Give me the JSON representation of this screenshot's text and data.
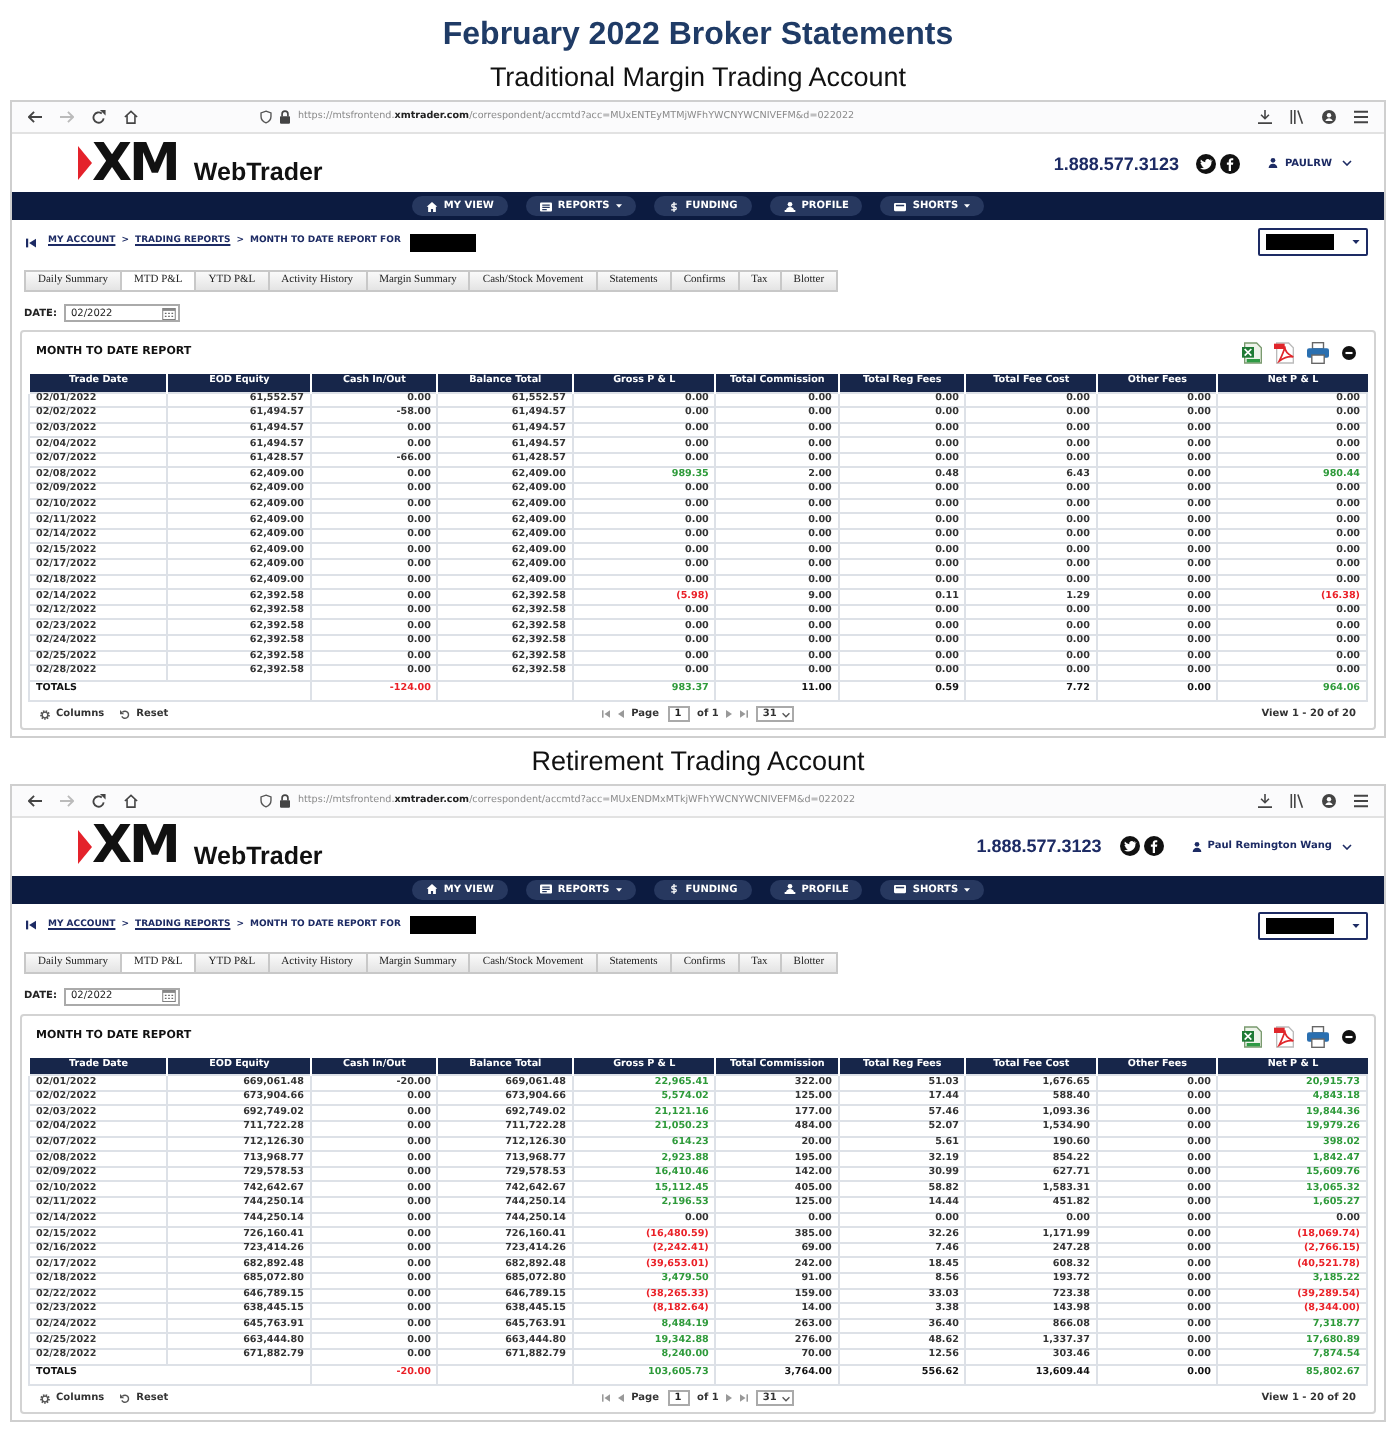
{
  "title": "February 2022 Broker Statements",
  "accounts": [
    {
      "heading": "Traditional Margin Trading Account",
      "browser": {
        "url": "https://mtsfrontend.**xmtrader.com**/correspondent/accmtd?acc=MUxENTEyMTMjWFhYWCNYWCNIVEFM&d=022022",
        "forward_disabled": true
      },
      "header": {
        "logo": "XM",
        "app_name": "WebTrader",
        "phone": "1.888.577.3123",
        "user": "PAULRW"
      },
      "nav": [
        {
          "label": "MY VIEW",
          "kind": "home",
          "dropdown": false
        },
        {
          "label": "REPORTS",
          "kind": "report",
          "dropdown": true
        },
        {
          "label": "FUNDING",
          "kind": "dollar",
          "dropdown": false
        },
        {
          "label": "PROFILE",
          "kind": "profile",
          "dropdown": false
        },
        {
          "label": "SHORTS",
          "kind": "shorts",
          "dropdown": true
        }
      ],
      "breadcrumb": {
        "items": [
          {
            "label": "MY ACCOUNT",
            "kind": "link"
          },
          {
            "separator": ">",
            "label": "TRADING REPORTS",
            "kind": "link"
          },
          {
            "separator": ">",
            "label": "MONTH TO DATE REPORT FOR",
            "kind": "current"
          }
        ],
        "redacted": true
      },
      "account_select": {
        "redacted": true
      },
      "tabs": [
        {
          "label": "Daily Summary",
          "selected": false
        },
        {
          "label": "MTD P&L",
          "selected": true
        },
        {
          "label": "YTD P&L",
          "selected": false
        },
        {
          "label": "Activity History",
          "selected": false
        },
        {
          "label": "Margin Summary",
          "selected": false
        },
        {
          "label": "Cash/Stock Movement",
          "selected": false
        },
        {
          "label": "Statements",
          "selected": false
        },
        {
          "label": "Confirms",
          "selected": false
        },
        {
          "label": "Tax",
          "selected": false
        },
        {
          "label": "Blotter",
          "selected": false
        }
      ],
      "date": {
        "label": "DATE:",
        "value": "02/2022"
      },
      "report": {
        "title": "MONTH TO DATE REPORT",
        "columns": [
          "Trade Date",
          "EOD Equity",
          "Cash In/Out",
          "Balance Total",
          "Gross P & L",
          "Total Commission",
          "Total Reg Fees",
          "Total Fee Cost",
          "Other Fees",
          "Net P & L"
        ],
        "rows": [
          {
            "cells": [
              "02/01/2022",
              "61,552.57",
              "0.00",
              "61,552.57",
              "0.00",
              "0.00",
              "0.00",
              "0.00",
              "0.00",
              "0.00"
            ],
            "color": "#333333"
          },
          {
            "cells": [
              "02/02/2022",
              "61,494.57",
              "-58.00",
              "61,494.57",
              "0.00",
              "0.00",
              "0.00",
              "0.00",
              "0.00",
              "0.00"
            ],
            "color": "#333333"
          },
          {
            "cells": [
              "02/03/2022",
              "61,494.57",
              "0.00",
              "61,494.57",
              "0.00",
              "0.00",
              "0.00",
              "0.00",
              "0.00",
              "0.00"
            ],
            "color": "#333333"
          },
          {
            "cells": [
              "02/04/2022",
              "61,494.57",
              "0.00",
              "61,494.57",
              "0.00",
              "0.00",
              "0.00",
              "0.00",
              "0.00",
              "0.00"
            ],
            "color": "#333333"
          },
          {
            "cells": [
              "02/07/2022",
              "61,428.57",
              "-66.00",
              "61,428.57",
              "0.00",
              "0.00",
              "0.00",
              "0.00",
              "0.00",
              "0.00"
            ],
            "color": "#333333"
          },
          {
            "cells": [
              "02/08/2022",
              "62,409.00",
              "0.00",
              "62,409.00",
              "989.35",
              "2.00",
              "0.48",
              "6.43",
              "0.00",
              "980.44"
            ],
            "color": "#2e9a3a"
          },
          {
            "cells": [
              "02/09/2022",
              "62,409.00",
              "0.00",
              "62,409.00",
              "0.00",
              "0.00",
              "0.00",
              "0.00",
              "0.00",
              "0.00"
            ],
            "color": "#333333"
          },
          {
            "cells": [
              "02/10/2022",
              "62,409.00",
              "0.00",
              "62,409.00",
              "0.00",
              "0.00",
              "0.00",
              "0.00",
              "0.00",
              "0.00"
            ],
            "color": "#333333"
          },
          {
            "cells": [
              "02/11/2022",
              "62,409.00",
              "0.00",
              "62,409.00",
              "0.00",
              "0.00",
              "0.00",
              "0.00",
              "0.00",
              "0.00"
            ],
            "color": "#333333"
          },
          {
            "cells": [
              "02/14/2022",
              "62,409.00",
              "0.00",
              "62,409.00",
              "0.00",
              "0.00",
              "0.00",
              "0.00",
              "0.00",
              "0.00"
            ],
            "color": "#333333"
          },
          {
            "cells": [
              "02/15/2022",
              "62,409.00",
              "0.00",
              "62,409.00",
              "0.00",
              "0.00",
              "0.00",
              "0.00",
              "0.00",
              "0.00"
            ],
            "color": "#333333"
          },
          {
            "cells": [
              "02/17/2022",
              "62,409.00",
              "0.00",
              "62,409.00",
              "0.00",
              "0.00",
              "0.00",
              "0.00",
              "0.00",
              "0.00"
            ],
            "color": "#333333"
          },
          {
            "cells": [
              "02/18/2022",
              "62,409.00",
              "0.00",
              "62,409.00",
              "0.00",
              "0.00",
              "0.00",
              "0.00",
              "0.00",
              "0.00"
            ],
            "color": "#333333"
          },
          {
            "cells": [
              "02/14/2022",
              "62,392.58",
              "0.00",
              "62,392.58",
              "(5.98)",
              "9.00",
              "0.11",
              "1.29",
              "0.00",
              "(16.38)"
            ],
            "color": "#ea2027"
          },
          {
            "cells": [
              "02/12/2022",
              "62,392.58",
              "0.00",
              "62,392.58",
              "0.00",
              "0.00",
              "0.00",
              "0.00",
              "0.00",
              "0.00"
            ],
            "color": "#333333"
          },
          {
            "cells": [
              "02/23/2022",
              "62,392.58",
              "0.00",
              "62,392.58",
              "0.00",
              "0.00",
              "0.00",
              "0.00",
              "0.00",
              "0.00"
            ],
            "color": "#333333"
          },
          {
            "cells": [
              "02/24/2022",
              "62,392.58",
              "0.00",
              "62,392.58",
              "0.00",
              "0.00",
              "0.00",
              "0.00",
              "0.00",
              "0.00"
            ],
            "color": "#333333"
          },
          {
            "cells": [
              "02/25/2022",
              "62,392.58",
              "0.00",
              "62,392.58",
              "0.00",
              "0.00",
              "0.00",
              "0.00",
              "0.00",
              "0.00"
            ],
            "color": "#333333"
          },
          {
            "cells": [
              "02/28/2022",
              "62,392.58",
              "0.00",
              "62,392.58",
              "0.00",
              "0.00",
              "0.00",
              "0.00",
              "0.00",
              "0.00"
            ],
            "color": "#333333"
          }
        ],
        "totals": {
          "label": "TOTALS",
          "cash_in_out": {
            "text": "-124.00",
            "color": "#ea2027"
          },
          "gross_pl": {
            "text": "983.37",
            "color": "#2e9a3a"
          },
          "total_commission": {
            "text": "11.00"
          },
          "total_reg_fees": {
            "text": "0.59"
          },
          "total_fee_cost": {
            "text": "7.72"
          },
          "other_fees": {
            "text": "0.00"
          },
          "net_pl": {
            "text": "964.06",
            "color": "#2e9a3a"
          }
        },
        "footer": {
          "columns_button": "Columns",
          "reset_button": "Reset",
          "page_label": "Page",
          "page": "1",
          "page_count": "of 1",
          "page_size": "31",
          "view_range": "View 1 - 20 of 20"
        }
      }
    },
    {
      "heading": "Retirement Trading Account",
      "browser": {
        "url": "https://mtsfrontend.**xmtrader.com**/correspondent/accmtd?acc=MUxENDMxMTkjWFhYWCNYWCNIVEFM&d=022022",
        "forward_disabled": true
      },
      "header": {
        "logo": "XM",
        "app_name": "WebTrader",
        "phone": "1.888.577.3123",
        "user": "Paul Remington Wang"
      },
      "nav": [
        {
          "label": "MY VIEW",
          "kind": "home",
          "dropdown": false
        },
        {
          "label": "REPORTS",
          "kind": "report",
          "dropdown": true
        },
        {
          "label": "FUNDING",
          "kind": "dollar",
          "dropdown": false
        },
        {
          "label": "PROFILE",
          "kind": "profile",
          "dropdown": false
        },
        {
          "label": "SHORTS",
          "kind": "shorts",
          "dropdown": true
        }
      ],
      "breadcrumb": {
        "items": [
          {
            "label": "MY ACCOUNT",
            "kind": "link"
          },
          {
            "separator": ">",
            "label": "TRADING REPORTS",
            "kind": "link"
          },
          {
            "separator": ">",
            "label": "MONTH TO DATE REPORT FOR",
            "kind": "current"
          }
        ],
        "redacted": true
      },
      "account_select": {
        "redacted": true
      },
      "tabs": [
        {
          "label": "Daily Summary",
          "selected": false
        },
        {
          "label": "MTD P&L",
          "selected": true
        },
        {
          "label": "YTD P&L",
          "selected": false
        },
        {
          "label": "Activity History",
          "selected": false
        },
        {
          "label": "Margin Summary",
          "selected": false
        },
        {
          "label": "Cash/Stock Movement",
          "selected": false
        },
        {
          "label": "Statements",
          "selected": false
        },
        {
          "label": "Confirms",
          "selected": false
        },
        {
          "label": "Tax",
          "selected": false
        },
        {
          "label": "Blotter",
          "selected": false
        }
      ],
      "date": {
        "label": "DATE:",
        "value": "02/2022"
      },
      "report": {
        "title": "MONTH TO DATE REPORT",
        "columns": [
          "Trade Date",
          "EOD Equity",
          "Cash In/Out",
          "Balance Total",
          "Gross P & L",
          "Total Commission",
          "Total Reg Fees",
          "Total Fee Cost",
          "Other Fees",
          "Net P & L"
        ],
        "rows": [
          {
            "cells": [
              "02/01/2022",
              "669,061.48",
              "-20.00",
              "669,061.48",
              "22,965.41",
              "322.00",
              "51.03",
              "1,676.65",
              "0.00",
              "20,915.73"
            ],
            "color": "#2e9a3a"
          },
          {
            "cells": [
              "02/02/2022",
              "673,904.66",
              "0.00",
              "673,904.66",
              "5,574.02",
              "125.00",
              "17.44",
              "588.40",
              "0.00",
              "4,843.18"
            ],
            "color": "#2e9a3a"
          },
          {
            "cells": [
              "02/03/2022",
              "692,749.02",
              "0.00",
              "692,749.02",
              "21,121.16",
              "177.00",
              "57.46",
              "1,093.36",
              "0.00",
              "19,844.36"
            ],
            "color": "#2e9a3a"
          },
          {
            "cells": [
              "02/04/2022",
              "711,722.28",
              "0.00",
              "711,722.28",
              "21,050.23",
              "484.00",
              "52.07",
              "1,534.90",
              "0.00",
              "19,979.26"
            ],
            "color": "#2e9a3a"
          },
          {
            "cells": [
              "02/07/2022",
              "712,126.30",
              "0.00",
              "712,126.30",
              "614.23",
              "20.00",
              "5.61",
              "190.60",
              "0.00",
              "398.02"
            ],
            "color": "#2e9a3a"
          },
          {
            "cells": [
              "02/08/2022",
              "713,968.77",
              "0.00",
              "713,968.77",
              "2,923.88",
              "195.00",
              "32.19",
              "854.22",
              "0.00",
              "1,842.47"
            ],
            "color": "#2e9a3a"
          },
          {
            "cells": [
              "02/09/2022",
              "729,578.53",
              "0.00",
              "729,578.53",
              "16,410.46",
              "142.00",
              "30.99",
              "627.71",
              "0.00",
              "15,609.76"
            ],
            "color": "#2e9a3a"
          },
          {
            "cells": [
              "02/10/2022",
              "742,642.67",
              "0.00",
              "742,642.67",
              "15,112.45",
              "405.00",
              "58.82",
              "1,583.31",
              "0.00",
              "13,065.32"
            ],
            "color": "#2e9a3a"
          },
          {
            "cells": [
              "02/11/2022",
              "744,250.14",
              "0.00",
              "744,250.14",
              "2,196.53",
              "125.00",
              "14.44",
              "451.82",
              "0.00",
              "1,605.27"
            ],
            "color": "#2e9a3a"
          },
          {
            "cells": [
              "02/14/2022",
              "744,250.14",
              "0.00",
              "744,250.14",
              "0.00",
              "0.00",
              "0.00",
              "0.00",
              "0.00",
              "0.00"
            ],
            "color": "#333333"
          },
          {
            "cells": [
              "02/15/2022",
              "726,160.41",
              "0.00",
              "726,160.41",
              "(16,480.59)",
              "385.00",
              "32.26",
              "1,171.99",
              "0.00",
              "(18,069.74)"
            ],
            "color": "#ea2027"
          },
          {
            "cells": [
              "02/16/2022",
              "723,414.26",
              "0.00",
              "723,414.26",
              "(2,242.41)",
              "69.00",
              "7.46",
              "247.28",
              "0.00",
              "(2,766.15)"
            ],
            "color": "#ea2027"
          },
          {
            "cells": [
              "02/17/2022",
              "682,892.48",
              "0.00",
              "682,892.48",
              "(39,653.01)",
              "242.00",
              "18.45",
              "608.32",
              "0.00",
              "(40,521.78)"
            ],
            "color": "#ea2027"
          },
          {
            "cells": [
              "02/18/2022",
              "685,072.80",
              "0.00",
              "685,072.80",
              "3,479.50",
              "91.00",
              "8.56",
              "193.72",
              "0.00",
              "3,185.22"
            ],
            "color": "#2e9a3a"
          },
          {
            "cells": [
              "02/22/2022",
              "646,789.15",
              "0.00",
              "646,789.15",
              "(38,265.33)",
              "159.00",
              "33.03",
              "723.38",
              "0.00",
              "(39,289.54)"
            ],
            "color": "#ea2027"
          },
          {
            "cells": [
              "02/23/2022",
              "638,445.15",
              "0.00",
              "638,445.15",
              "(8,182.64)",
              "14.00",
              "3.38",
              "143.98",
              "0.00",
              "(8,344.00)"
            ],
            "color": "#ea2027"
          },
          {
            "cells": [
              "02/24/2022",
              "645,763.91",
              "0.00",
              "645,763.91",
              "8,484.19",
              "263.00",
              "36.40",
              "866.08",
              "0.00",
              "7,318.77"
            ],
            "color": "#2e9a3a"
          },
          {
            "cells": [
              "02/25/2022",
              "663,444.80",
              "0.00",
              "663,444.80",
              "19,342.88",
              "276.00",
              "48.62",
              "1,337.37",
              "0.00",
              "17,680.89"
            ],
            "color": "#2e9a3a"
          },
          {
            "cells": [
              "02/28/2022",
              "671,882.79",
              "0.00",
              "671,882.79",
              "8,240.00",
              "70.00",
              "12.56",
              "303.46",
              "0.00",
              "7,874.54"
            ],
            "color": "#2e9a3a"
          }
        ],
        "totals": {
          "label": "TOTALS",
          "cash_in_out": {
            "text": "-20.00",
            "color": "#ea2027"
          },
          "gross_pl": {
            "text": "103,605.73",
            "color": "#2e9a3a"
          },
          "total_commission": {
            "text": "3,764.00"
          },
          "total_reg_fees": {
            "text": "556.62"
          },
          "total_fee_cost": {
            "text": "13,609.44"
          },
          "other_fees": {
            "text": "0.00"
          },
          "net_pl": {
            "text": "85,802.67",
            "color": "#2e9a3a"
          }
        },
        "footer": {
          "columns_button": "Columns",
          "reset_button": "Reset",
          "page_label": "Page",
          "page": "1",
          "page_count": "of 1",
          "page_size": "31",
          "view_range": "View 1 - 20 of 20"
        }
      }
    }
  ]
}
